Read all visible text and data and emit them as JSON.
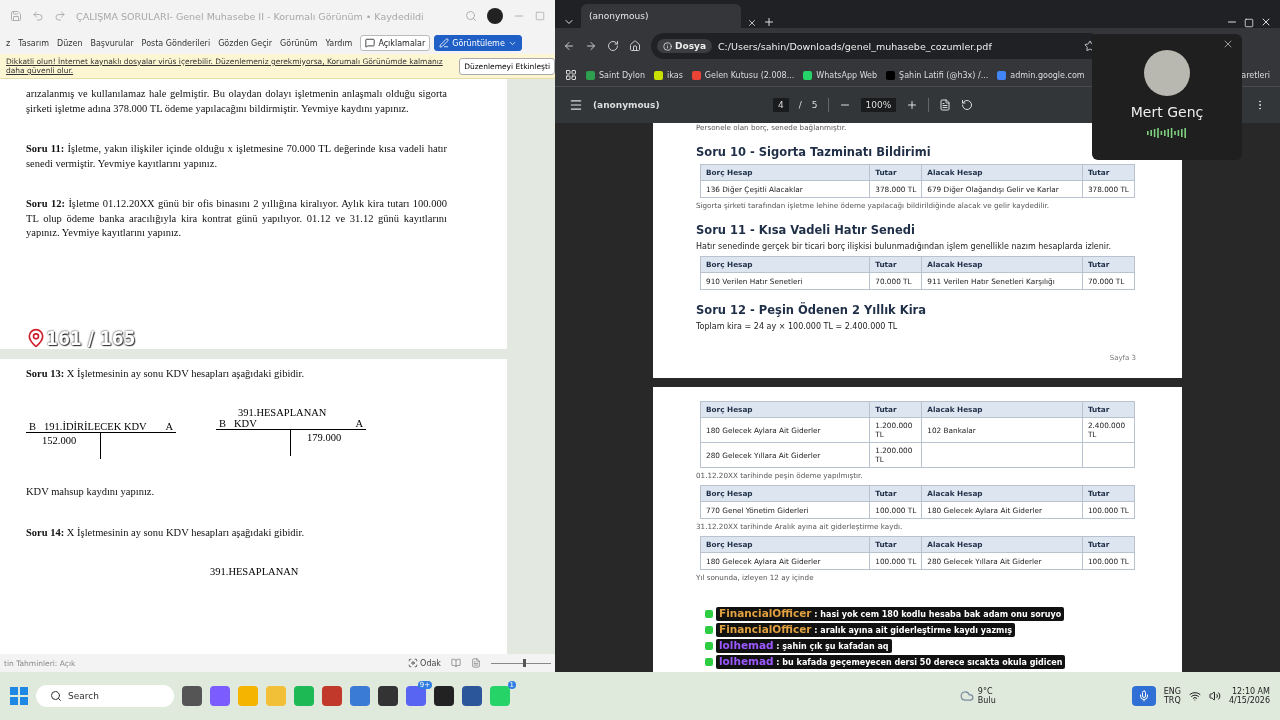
{
  "word": {
    "title": "ÇALIŞMA SORULARI- Genel Muhasebe II - Korumalı Görünüm • Kaydedildi",
    "menu": [
      "z",
      "Tasarım",
      "Düzen",
      "Başvurular",
      "Posta Gönderileri",
      "Gözden Geçir",
      "Görünüm",
      "Yardım"
    ],
    "comments_button": "Açıklamalar",
    "view_button": "Görüntüleme",
    "warning": {
      "text": "Dikkatli olun! İnternet kaynaklı dosyalar virüs içerebilir. Düzenlemeniz gerekmiyorsa, Korumalı Görünümde kalmanız daha güvenli olur.",
      "button": "Düzenlemeyi Etkinleşti"
    },
    "pages": [
      {
        "blocks": [
          {
            "kind": "para",
            "text": "arızalanmış ve kullanılamaz hale gelmiştir. Bu olaydan dolayı işletmenin anlaşmalı olduğu sigorta şirketi işletme adına 378.000 TL ödeme yapılacağını bildirmiştir. Yevmiye kaydını yapınız."
          },
          {
            "kind": "para",
            "text": "**Soru 11:**  İşletme, yakın ilişkiler içinde olduğu x işletmesine 70.000 TL değerinde kısa vadeli hatır senedi vermiştir. Yevmiye kayıtlarını yapınız."
          },
          {
            "kind": "para",
            "text": "**Soru 12:** İşletme 01.12.20XX günü bir ofis binasını 2 yıllığına kiralıyor. Aylık kira tutarı 100.000 TL olup ödeme banka aracılığıyla kira kontrat günü yapılıyor. 01.12 ve 31.12 günü kayıtlarını yapınız. Yevmiye kayıtlarını yapınız."
          },
          {
            "kind": "counter",
            "text": "161 / 165"
          }
        ]
      },
      {
        "blocks": [
          {
            "kind": "para",
            "text": "**Soru 13:** X İşletmesinin ay sonu KDV hesapları aşağıdaki gibidir."
          },
          {
            "kind": "taccounts",
            "accounts": [
              {
                "title": "191.İDİRİLECEK KDV",
                "debit_label": "B",
                "credit_label": "A",
                "debit": "152.000"
              },
              {
                "top": "391.HESAPLANAN",
                "title": "KDV",
                "debit_label": "B",
                "credit_label": "A",
                "credit": "179.000"
              }
            ]
          },
          {
            "kind": "para",
            "text": "KDV mahsup kaydını yapınız."
          },
          {
            "kind": "para",
            "text": "**Soru 14:**  X İşletmesinin ay sonu KDV hesapları aşağıdaki gibidir."
          },
          {
            "kind": "fragment",
            "text": "391.HESAPLANAN"
          }
        ]
      }
    ],
    "status": {
      "left": "tin Tahminleri: Açık",
      "focus": "Odak",
      "zoom_slider": {
        "level": 0.55
      }
    }
  },
  "browser": {
    "tabs": [
      {
        "title": "(anonymous)",
        "selected": true
      }
    ],
    "address": {
      "chip": "Dosya",
      "url": "C:/Users/sahin/Downloads/genel_muhasebe_cozumler.pdf"
    },
    "bookmarks": [
      {
        "label": "Saint Dylon",
        "color": "#2e9e4f"
      },
      {
        "label": "ikas",
        "color": "#c8e000"
      },
      {
        "label": "Gelen Kutusu (2.008...",
        "color": "#ea4335"
      },
      {
        "label": "WhatsApp Web",
        "color": "#25d366"
      },
      {
        "label": "Şahin Latifi (@h3x) /...",
        "color": "#000000"
      },
      {
        "label": "admin.google.com",
        "color": "#4285f4"
      },
      {
        "label": "aretleri"
      }
    ],
    "pdf": {
      "title": "(anonymous)",
      "page": "4",
      "separator": "/",
      "pages": "5",
      "zoom": "100%",
      "sheets": [
        {
          "blocks": [
            {
              "kind": "caption",
              "text": "Personele olan borç, senede bağlanmıştır."
            },
            {
              "kind": "heading",
              "text": "Soru 10 - Sigorta Tazminatı Bildirimi"
            },
            {
              "kind": "table",
              "columns": [
                "Borç Hesap",
                "Tutar",
                "Alacak Hesap",
                "Tutar"
              ],
              "rows": [
                {
                  "debit_account": "136 Diğer Çeşitli Alacaklar",
                  "debit_amount": "378.000 TL",
                  "credit_account": "679 Diğer Olağandışı Gelir ve Karlar",
                  "credit_amount": "378.000 TL"
                }
              ]
            },
            {
              "kind": "caption",
              "text": "Sigorta şirketi tarafından işletme lehine ödeme yapılacağı bildirildiğinde alacak ve gelir kaydedilir."
            },
            {
              "kind": "heading",
              "text": "Soru 11 - Kısa Vadeli Hatır Senedi"
            },
            {
              "kind": "text",
              "text": "Hatır senedinde gerçek bir ticari borç ilişkisi bulunmadığından işlem genellikle nazım hesaplarda izlenir."
            },
            {
              "kind": "table",
              "columns": [
                "Borç Hesap",
                "Tutar",
                "Alacak Hesap",
                "Tutar"
              ],
              "rows": [
                {
                  "debit_account": "910 Verilen Hatır Senetleri",
                  "debit_amount": "70.000 TL",
                  "credit_account": "911 Verilen Hatır Senetleri Karşılığı",
                  "credit_amount": "70.000 TL"
                }
              ]
            },
            {
              "kind": "heading",
              "text": "Soru 12 - Peşin Ödenen 2 Yıllık Kira"
            },
            {
              "kind": "text",
              "text": "Toplam kira = 24 ay × 100.000 TL = 2.400.000 TL"
            },
            {
              "kind": "footer",
              "text": "Sayfa 3"
            }
          ]
        },
        {
          "blocks": [
            {
              "kind": "table",
              "columns": [
                "Borç Hesap",
                "Tutar",
                "Alacak Hesap",
                "Tutar"
              ],
              "rows": [
                {
                  "debit_account": "180 Gelecek Aylara Ait Giderler",
                  "debit_amount": "1.200.000 TL",
                  "credit_account": "102 Bankalar",
                  "credit_amount": "2.400.000 TL"
                },
                {
                  "debit_account": "280 Gelecek Yıllara Ait Giderler",
                  "debit_amount": "1.200.000 TL"
                }
              ]
            },
            {
              "kind": "caption",
              "text": "01.12.20XX tarihinde peşin ödeme yapılmıştır."
            },
            {
              "kind": "table",
              "columns": [
                "Borç Hesap",
                "Tutar",
                "Alacak Hesap",
                "Tutar"
              ],
              "rows": [
                {
                  "debit_account": "770 Genel Yönetim Giderleri",
                  "debit_amount": "100.000 TL",
                  "credit_account": "180 Gelecek Aylara Ait Giderler",
                  "credit_amount": "100.000 TL"
                }
              ]
            },
            {
              "kind": "caption",
              "text": "31.12.20XX tarihinde Aralık ayına ait giderleştirme kaydı."
            },
            {
              "kind": "table",
              "columns": [
                "Borç Hesap",
                "Tutar",
                "Alacak Hesap",
                "Tutar"
              ],
              "rows": [
                {
                  "debit_account": "180 Gelecek Aylara Ait Giderler",
                  "debit_amount": "100.000 TL",
                  "credit_account": "280 Gelecek Yıllara Ait Giderler",
                  "credit_amount": "100.000 TL"
                }
              ]
            },
            {
              "kind": "caption",
              "text": "Yıl sonunda, izleyen 12 ay içinde"
            }
          ]
        }
      ]
    }
  },
  "call": {
    "name": "Mert Genç"
  },
  "chat": [
    {
      "user": "FinancialOfficer",
      "color": "#e0a040",
      "separator": ":",
      "text": "hasi yok cem 180 kodlu hesaba bak adam onu soruyo"
    },
    {
      "user": "FinancialOfficer",
      "color": "#e0a040",
      "separator": ":",
      "text": "aralık ayına ait giderleştirme kaydı yazmış"
    },
    {
      "user": "lolhemad",
      "color": "#9b59ff",
      "separator": ":",
      "text": "şahin çık şu kafadan aq"
    },
    {
      "user": "lolhemad",
      "color": "#9b59ff",
      "separator": ":",
      "text": "bu kafada geçemeyecen dersi 50 derece sıcakta okula gidicen"
    }
  ],
  "taskbar": {
    "search": "Search",
    "apps": [
      {
        "kind": "taskview"
      },
      {
        "kind": "copilot"
      },
      {
        "kind": "chrome"
      },
      {
        "kind": "files"
      },
      {
        "kind": "spotify"
      },
      {
        "kind": "game"
      },
      {
        "kind": "app"
      },
      {
        "kind": "terminal"
      },
      {
        "kind": "discord",
        "badge": "9+"
      },
      {
        "kind": "obs"
      },
      {
        "kind": "word"
      },
      {
        "kind": "whatsapp",
        "badge": "1"
      }
    ],
    "weather": {
      "temp": "9°C",
      "label": "Bulu"
    },
    "lang": "ENG",
    "layout": "TRQ",
    "time": "12:10 AM",
    "date": "4/15/2026"
  }
}
